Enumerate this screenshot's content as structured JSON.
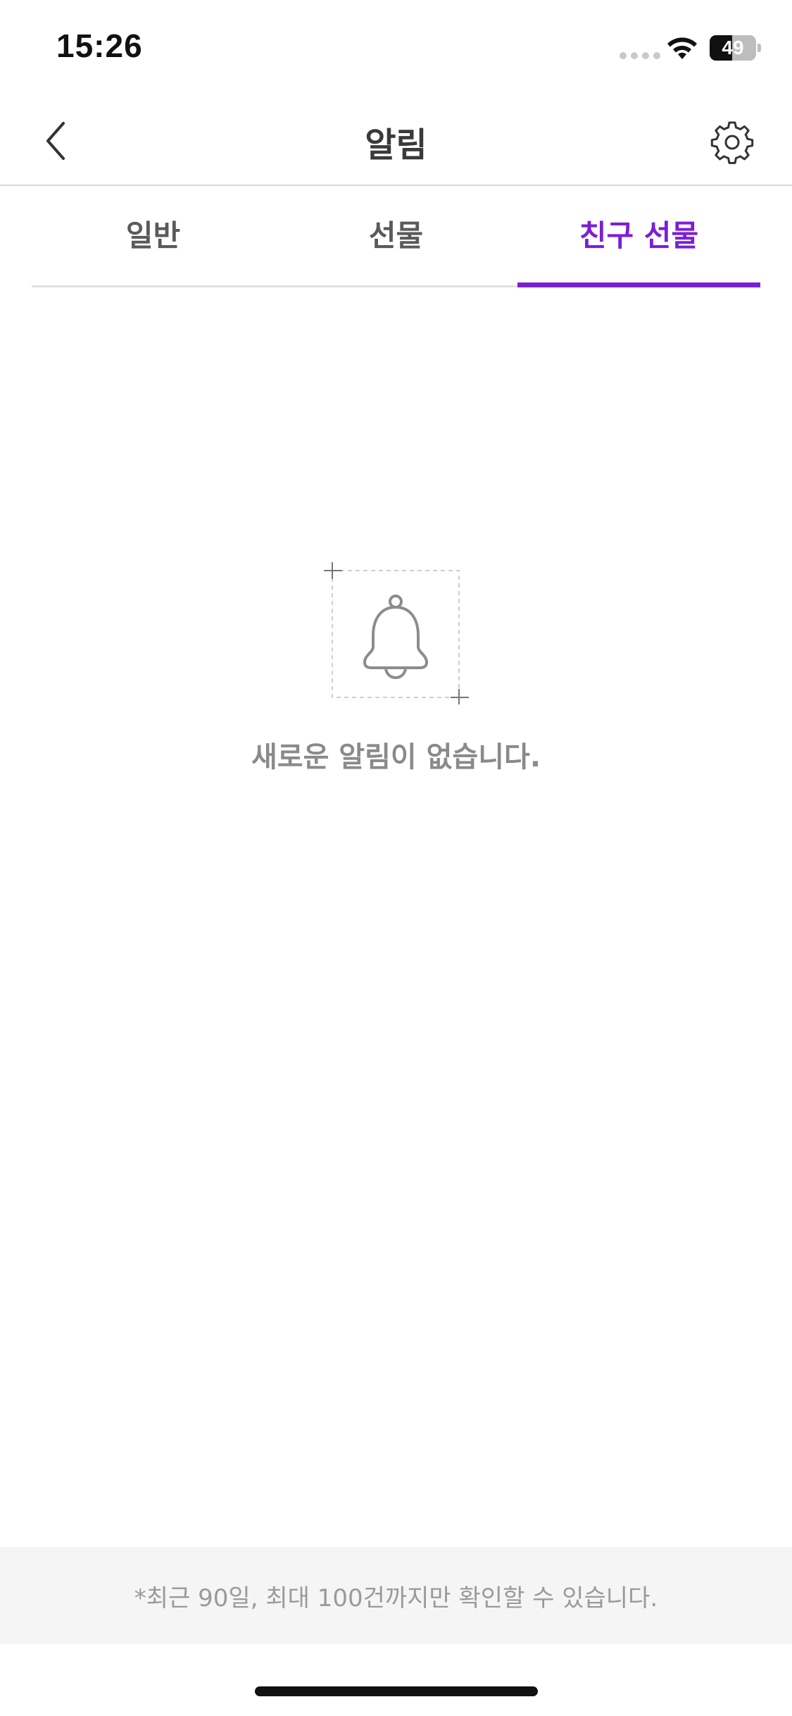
{
  "status_bar": {
    "time": "15:26",
    "battery_level": "49",
    "battery_fraction": 0.49
  },
  "header": {
    "title": "알림",
    "back_icon": "chevron-left-icon",
    "settings_icon": "gear-icon"
  },
  "tabs": [
    {
      "label": "일반",
      "active": false
    },
    {
      "label": "선물",
      "active": false
    },
    {
      "label": "친구 선물",
      "active": true
    }
  ],
  "empty_state": {
    "icon": "bell-icon",
    "message": "새로운 알림이 없습니다."
  },
  "footer": {
    "note": "*최근 90일, 최대 100건까지만 확인할 수 있습니다."
  },
  "colors": {
    "accent": "#7b1fd6",
    "tab_inactive": "#5a5a5a",
    "muted_text": "#8a8a8a",
    "footer_bg": "#f5f5f5"
  }
}
